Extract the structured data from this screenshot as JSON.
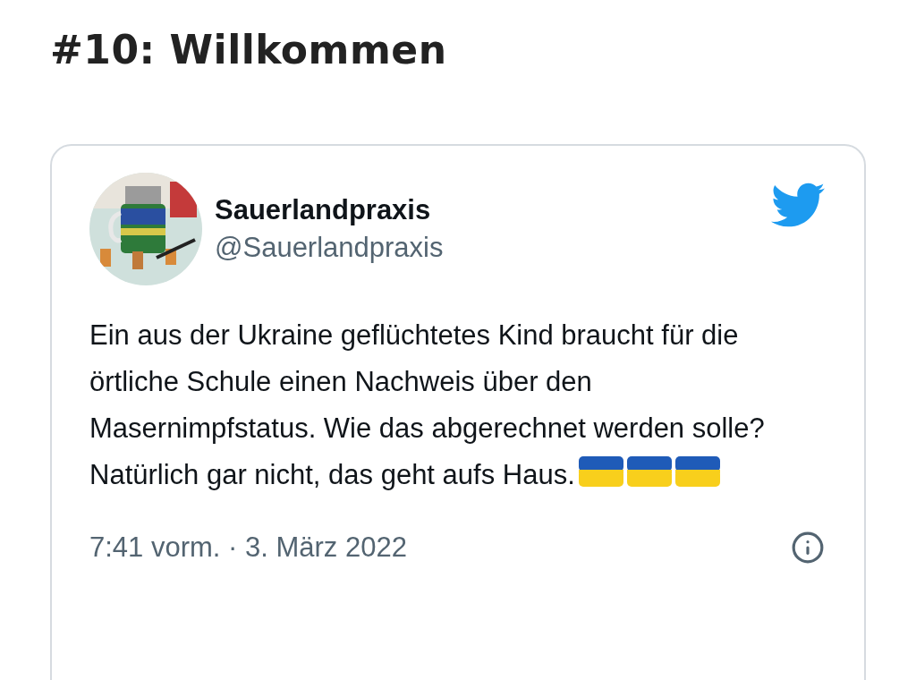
{
  "heading": "#10: Willkommen",
  "tweet": {
    "avatar": {
      "kind": "picture"
    },
    "name": "Sauerlandpraxis",
    "handle": "@Sauerlandpraxis",
    "paragraphs": [
      "Ein aus der Ukraine geflüchtetes Kind braucht für die örtliche Schule einen Nachweis über den Masernimpfstatus. Wie das abgerechnet werden solle?",
      "Natürlich gar nicht, das geht aufs Haus."
    ],
    "emoji": [
      {
        "kind": "ukraine-flag"
      },
      {
        "kind": "ukraine-flag"
      },
      {
        "kind": "ukraine-flag"
      }
    ],
    "timestamp": "7:41 vorm. · 3. März 2022"
  }
}
